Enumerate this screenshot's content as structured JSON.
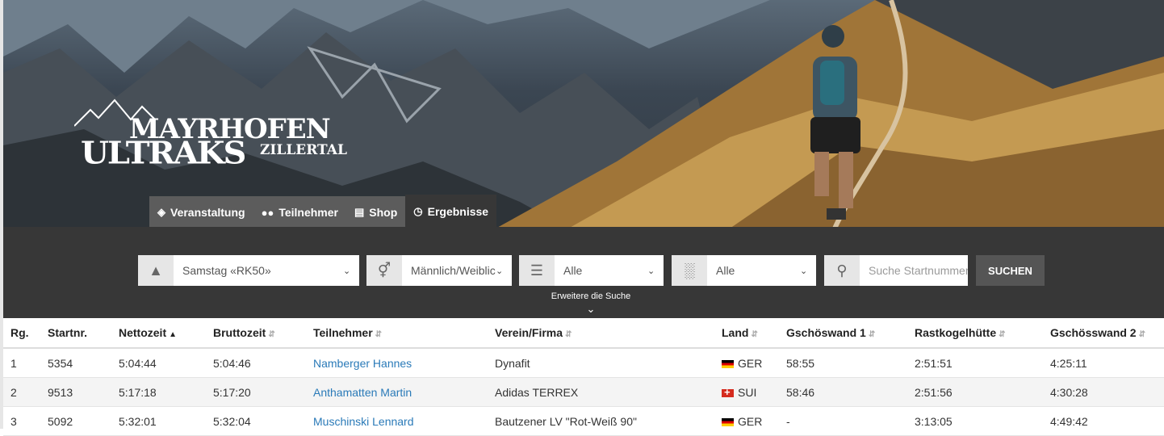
{
  "logo": {
    "line1": "MAYRHOFEN",
    "line2": "ULTRAKS",
    "line3": "ZILLERTAL"
  },
  "tabs": [
    {
      "label": "Veranstaltung",
      "icon": "tag-icon"
    },
    {
      "label": "Teilnehmer",
      "icon": "users-icon"
    },
    {
      "label": "Shop",
      "icon": "basket-icon"
    },
    {
      "label": "Ergebnisse",
      "icon": "clock-icon",
      "active": true
    }
  ],
  "filters": {
    "event": {
      "value": "Samstag «RK50»",
      "icon": "road-icon"
    },
    "gender": {
      "value": "Männlich/Weiblich",
      "icon": "gender-icon"
    },
    "category": {
      "value": "Alle",
      "icon": "list-icon"
    },
    "age": {
      "value": "Alle",
      "icon": "cake-icon"
    },
    "search": {
      "placeholder": "Suche Startnummer",
      "icon": "search-icon"
    },
    "search_button": "SUCHEN",
    "extended": "Erweitere die Suche"
  },
  "table": {
    "headers": [
      "Rg.",
      "Startnr.",
      "Nettozeit",
      "Bruttozeit",
      "Teilnehmer",
      "Verein/Firma",
      "Land",
      "Gschöswand 1",
      "Rastkogelhütte",
      "Gschösswand 2"
    ],
    "rows": [
      {
        "rank": "1",
        "bib": "5354",
        "net": "5:04:44",
        "gross": "5:04:46",
        "name": "Namberger Hannes",
        "club": "Dynafit",
        "country": "GER",
        "cp1": "58:55",
        "cp2": "2:51:51",
        "cp3": "4:25:11"
      },
      {
        "rank": "2",
        "bib": "9513",
        "net": "5:17:18",
        "gross": "5:17:20",
        "name": "Anthamatten Martin",
        "club": "Adidas TERREX",
        "country": "SUI",
        "cp1": "58:46",
        "cp2": "2:51:56",
        "cp3": "4:30:28"
      },
      {
        "rank": "3",
        "bib": "5092",
        "net": "5:32:01",
        "gross": "5:32:04",
        "name": "Muschinski Lennard",
        "club": "Bautzener LV \"Rot-Weiß 90\"",
        "country": "GER",
        "cp1": "-",
        "cp2": "3:13:05",
        "cp3": "4:49:42"
      }
    ]
  }
}
